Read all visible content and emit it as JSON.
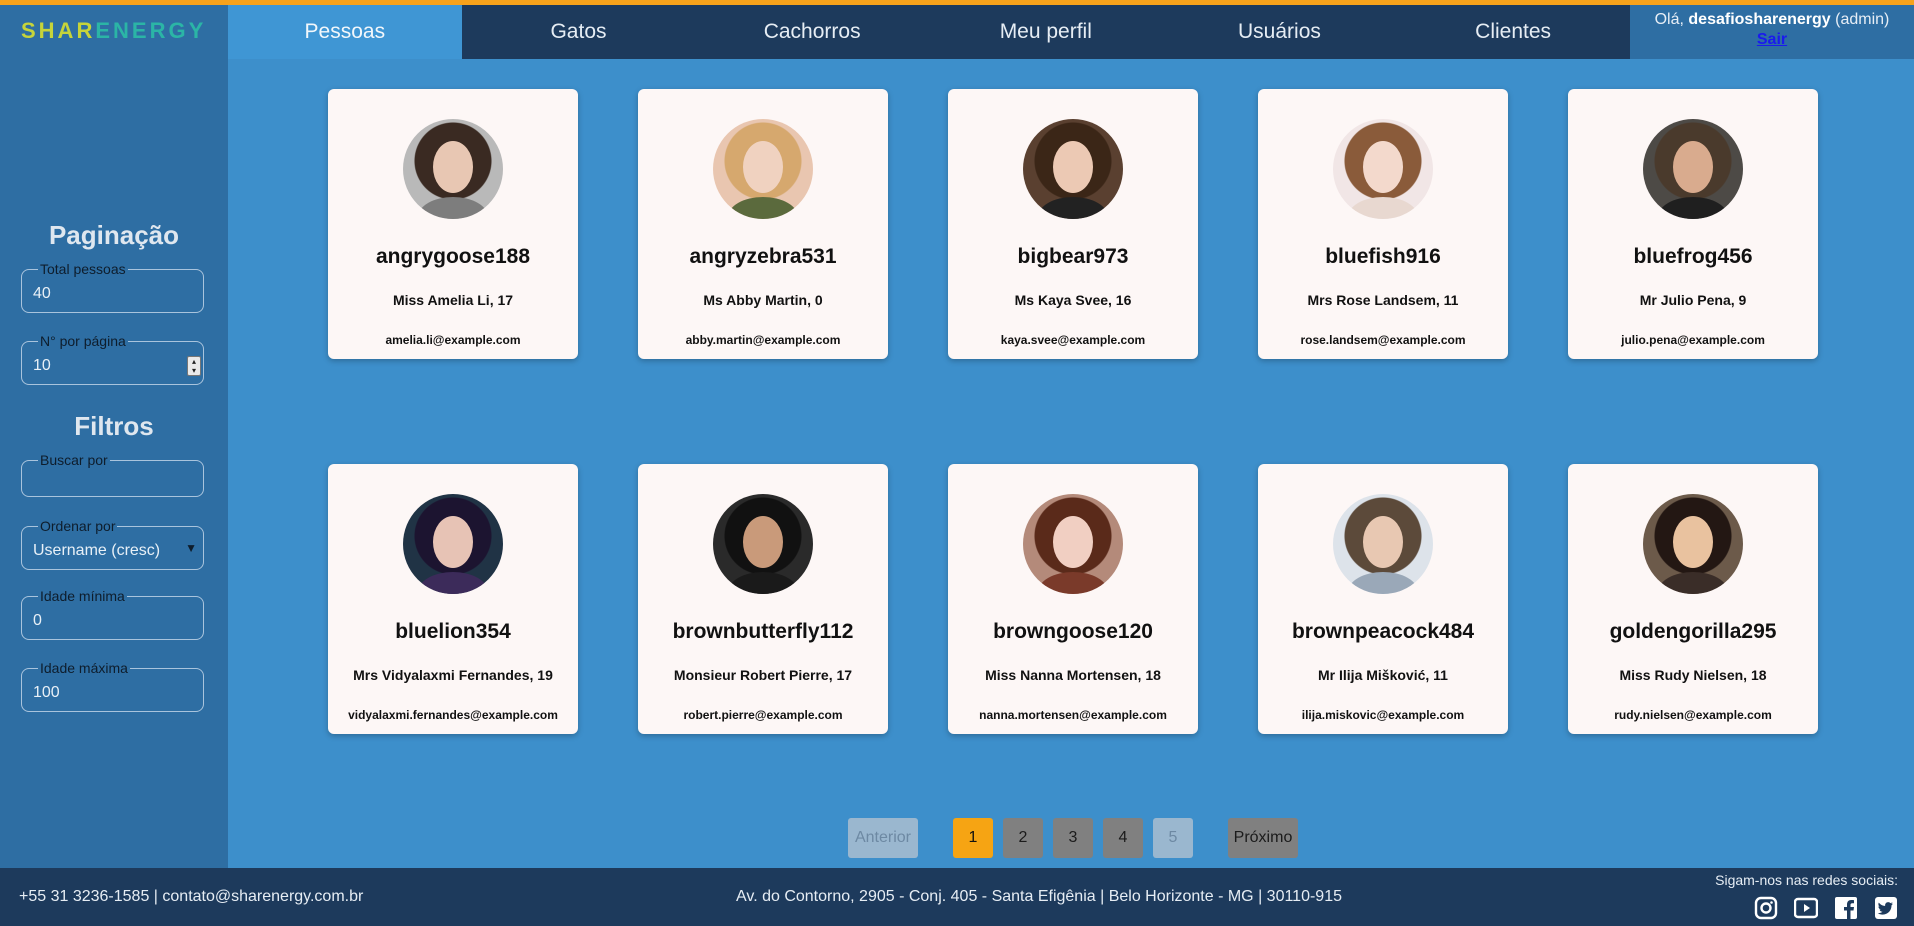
{
  "brand": {
    "logo_part1": "SHAR",
    "logo_part2": "ENERGY"
  },
  "nav": {
    "tabs": [
      {
        "label": "Pessoas",
        "active": true
      },
      {
        "label": "Gatos"
      },
      {
        "label": "Cachorros"
      },
      {
        "label": "Meu perfil"
      },
      {
        "label": "Usuários"
      },
      {
        "label": "Clientes"
      }
    ]
  },
  "user": {
    "greeting": "Olá,",
    "name": "desafiosharenergy",
    "role": "(admin)",
    "logout": "Sair"
  },
  "sidebar": {
    "pagination_title": "Paginação",
    "total_label": "Total pessoas",
    "total_value": "40",
    "per_page_label": "N° por página",
    "per_page_value": "10",
    "filters_title": "Filtros",
    "search_label": "Buscar por",
    "search_value": "",
    "order_label": "Ordenar por",
    "order_value": "Username (cresc)",
    "min_age_label": "Idade mínima",
    "min_age_value": "0",
    "max_age_label": "Idade máxima",
    "max_age_value": "100"
  },
  "cards": [
    {
      "username": "angrygoose188",
      "fullname": "Miss Amelia Li, 17",
      "email": "amelia.li@example.com",
      "hair": "#3a2a22",
      "skin": "#e8c7b3",
      "bg": "#b9b9b9",
      "shirt": "#7d7d7d"
    },
    {
      "username": "angryzebra531",
      "fullname": "Ms Abby Martin, 0",
      "email": "abby.martin@example.com",
      "hair": "#d6a86e",
      "skin": "#f0d2c0",
      "bg": "#e9c6b0",
      "shirt": "#5b6a3d"
    },
    {
      "username": "bigbear973",
      "fullname": "Ms Kaya Svee, 16",
      "email": "kaya.svee@example.com",
      "hair": "#3b2617",
      "skin": "#ecc9b4",
      "bg": "#5a4030",
      "shirt": "#222222"
    },
    {
      "username": "bluefish916",
      "fullname": "Mrs Rose Landsem, 11",
      "email": "rose.landsem@example.com",
      "hair": "#8a5b3a",
      "skin": "#f3d9cc",
      "bg": "#f1e6e6",
      "shirt": "#e8d8d0"
    },
    {
      "username": "bluefrog456",
      "fullname": "Mr Julio Pena, 9",
      "email": "julio.pena@example.com",
      "hair": "#4a3a2c",
      "skin": "#d9ab8e",
      "bg": "#4d4a46",
      "shirt": "#1f1f1f"
    },
    {
      "username": "bluelion354",
      "fullname": "Mrs Vidyalaxmi Fernandes, 19",
      "email": "vidyalaxmi.fernandes@example.com",
      "hair": "#1c1430",
      "skin": "#e7c3b5",
      "bg": "#203345",
      "shirt": "#3c2b5a"
    },
    {
      "username": "brownbutterfly112",
      "fullname": "Monsieur Robert Pierre, 17",
      "email": "robert.pierre@example.com",
      "hair": "#111111",
      "skin": "#c99a7a",
      "bg": "#2a2a2a",
      "shirt": "#1a1a1a"
    },
    {
      "username": "browngoose120",
      "fullname": "Miss Nanna Mortensen, 18",
      "email": "nanna.mortensen@example.com",
      "hair": "#5a2a1a",
      "skin": "#f1cfc2",
      "bg": "#b48a7a",
      "shirt": "#7a3a2a"
    },
    {
      "username": "brownpeacock484",
      "fullname": "Mr Ilija Mišković, 11",
      "email": "ilija.miskovic@example.com",
      "hair": "#5c4a3a",
      "skin": "#e8c8b2",
      "bg": "#dde3ea",
      "shirt": "#9aa8b8"
    },
    {
      "username": "goldengorilla295",
      "fullname": "Miss Rudy Nielsen, 18",
      "email": "rudy.nielsen@example.com",
      "hair": "#231713",
      "skin": "#e9c29f",
      "bg": "#6c5a4a",
      "shirt": "#3a2d28"
    }
  ],
  "pagination": {
    "prev": "Anterior",
    "pages": [
      "1",
      "2",
      "3",
      "4",
      "5"
    ],
    "current": "1",
    "next": "Próximo"
  },
  "footer": {
    "contact": "+55 31 3236-1585 | contato@sharenergy.com.br",
    "address": "Av. do Contorno, 2905 - Conj. 405 - Santa Efigênia | Belo Horizonte - MG | 30110-915",
    "social_label": "Sigam-nos nas redes sociais:",
    "social_icons": [
      "instagram-icon",
      "youtube-icon",
      "facebook-icon",
      "twitter-icon"
    ]
  },
  "colors": {
    "accent": "#f7a21b",
    "nav_bg": "#1d3a5c",
    "main_bg": "#3d8fcb",
    "sidebar_bg": "#2e6ea3"
  }
}
